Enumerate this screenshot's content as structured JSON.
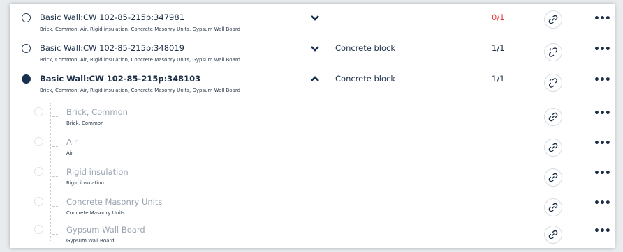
{
  "rows": [
    {
      "title": "Basic Wall:CW 102-85-215p:347981",
      "layers": "Brick, Common, Air, Rigid insulation, Concrete Masonry Units, Gypsum Wall Board",
      "material": "",
      "count": "0/1",
      "count_color": "#e53b3b",
      "expanded": false,
      "selected": false,
      "action_icon": "link-icon"
    },
    {
      "title": "Basic Wall:CW 102-85-215p:348019",
      "layers": "Brick, Common, Air, Rigid insulation, Concrete Masonry Units, Gypsum Wall Board",
      "material": "Concrete block",
      "count": "1/1",
      "expanded": false,
      "selected": false,
      "action_icon": "unlink-icon"
    },
    {
      "title": "Basic Wall:CW 102-85-215p:348103",
      "layers": "Brick, Common, Air, Rigid insulation, Concrete Masonry Units, Gypsum Wall Board",
      "material": "Concrete block",
      "count": "1/1",
      "expanded": true,
      "selected": true,
      "action_icon": "unlink-icon"
    }
  ],
  "children": [
    {
      "title": "Brick, Common",
      "sub": "Brick, Common",
      "action_icon": "link-icon"
    },
    {
      "title": "Air",
      "sub": "Air",
      "action_icon": "link-icon"
    },
    {
      "title": "Rigid insulation",
      "sub": "Rigid insulation",
      "action_icon": "link-icon"
    },
    {
      "title": "Concrete Masonry Units",
      "sub": "Concrete Masonry Units",
      "action_icon": "link-icon"
    },
    {
      "title": "Gypsum Wall Board",
      "sub": "Gypsum Wall Board",
      "action_icon": "link-icon"
    }
  ],
  "more_label": "•••",
  "colors": {
    "accent": "#16304d",
    "error": "#e53b3b",
    "muted": "#9aa4b1"
  }
}
